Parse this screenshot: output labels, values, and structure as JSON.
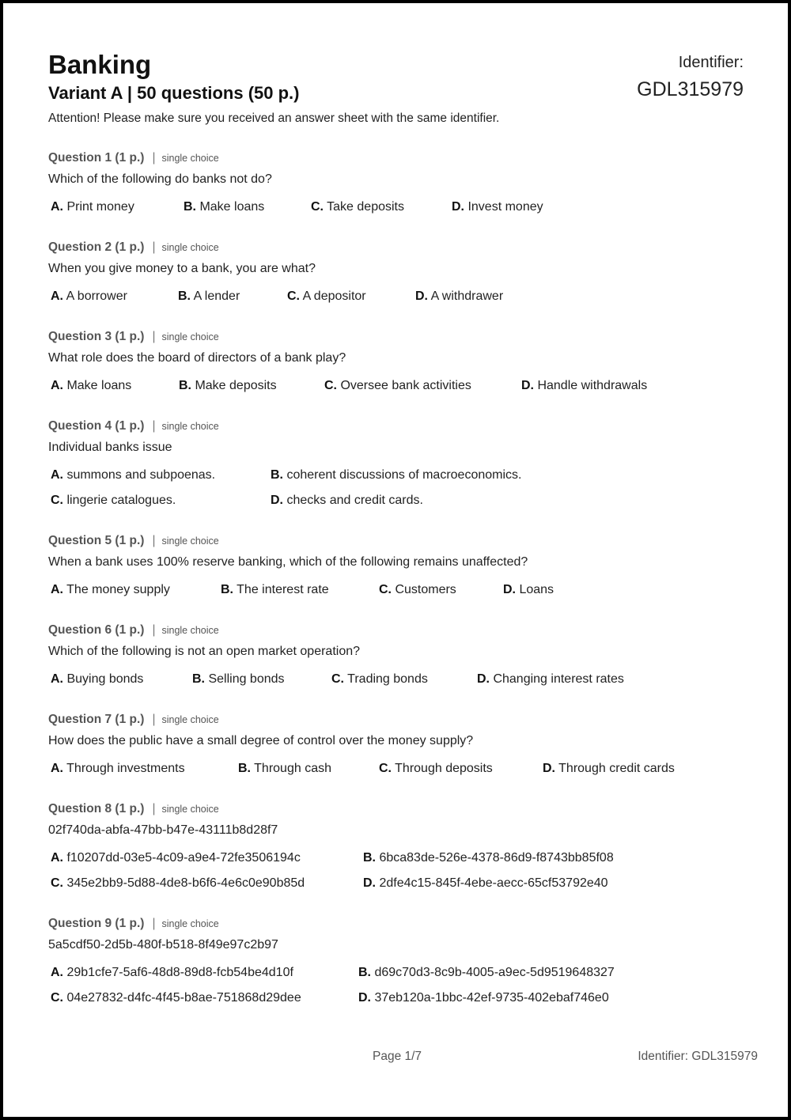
{
  "header": {
    "title": "Banking",
    "subtitle": "Variant A | 50 questions (50 p.)",
    "attention": "Attention! Please make sure you received an answer sheet with the same identifier.",
    "identifier_label": "Identifier:",
    "identifier_value": "GDL315979"
  },
  "questions": [
    {
      "heading": "Question 1 (1 p.)",
      "type": "single choice",
      "text": "Which of the following do banks not do?",
      "options": [
        {
          "letter": "A.",
          "text": "Print money"
        },
        {
          "letter": "B.",
          "text": "Make loans"
        },
        {
          "letter": "C.",
          "text": "Take deposits"
        },
        {
          "letter": "D.",
          "text": "Invest money"
        }
      ]
    },
    {
      "heading": "Question 2 (1 p.)",
      "type": "single choice",
      "text": "When you give money to a bank, you are what?",
      "options": [
        {
          "letter": "A.",
          "text": "A borrower"
        },
        {
          "letter": "B.",
          "text": "A lender"
        },
        {
          "letter": "C.",
          "text": "A depositor"
        },
        {
          "letter": "D.",
          "text": "A withdrawer"
        }
      ]
    },
    {
      "heading": "Question 3 (1 p.)",
      "type": "single choice",
      "text": "What role does the board of directors of a bank play?",
      "options": [
        {
          "letter": "A.",
          "text": "Make loans"
        },
        {
          "letter": "B.",
          "text": "Make deposits"
        },
        {
          "letter": "C.",
          "text": "Oversee bank activities"
        },
        {
          "letter": "D.",
          "text": "Handle withdrawals"
        }
      ]
    },
    {
      "heading": "Question 4 (1 p.)",
      "type": "single choice",
      "text": "Individual banks issue",
      "options": [
        {
          "letter": "A.",
          "text": "summons and subpoenas."
        },
        {
          "letter": "B.",
          "text": "coherent discussions of macroeconomics."
        },
        {
          "letter": "C.",
          "text": "lingerie catalogues."
        },
        {
          "letter": "D.",
          "text": "checks and credit cards."
        }
      ]
    },
    {
      "heading": "Question 5 (1 p.)",
      "type": "single choice",
      "text": "When a bank uses 100% reserve banking, which of the following remains unaffected?",
      "options": [
        {
          "letter": "A.",
          "text": "The money supply"
        },
        {
          "letter": "B.",
          "text": "The interest rate"
        },
        {
          "letter": "C.",
          "text": "Customers"
        },
        {
          "letter": "D.",
          "text": "Loans"
        }
      ]
    },
    {
      "heading": "Question 6 (1 p.)",
      "type": "single choice",
      "text": "Which of the following is not an open market operation?",
      "options": [
        {
          "letter": "A.",
          "text": "Buying bonds"
        },
        {
          "letter": "B.",
          "text": "Selling bonds"
        },
        {
          "letter": "C.",
          "text": "Trading bonds"
        },
        {
          "letter": "D.",
          "text": "Changing interest rates"
        }
      ]
    },
    {
      "heading": "Question 7 (1 p.)",
      "type": "single choice",
      "text": "How does the public have a small degree of control over the money supply?",
      "options": [
        {
          "letter": "A.",
          "text": "Through investments"
        },
        {
          "letter": "B.",
          "text": "Through cash"
        },
        {
          "letter": "C.",
          "text": "Through deposits"
        },
        {
          "letter": "D.",
          "text": "Through credit cards"
        }
      ]
    },
    {
      "heading": "Question 8 (1 p.)",
      "type": "single choice",
      "text": "02f740da-abfa-47bb-b47e-43111b8d28f7",
      "options": [
        {
          "letter": "A.",
          "text": "f10207dd-03e5-4c09-a9e4-72fe3506194c"
        },
        {
          "letter": "B.",
          "text": "6bca83de-526e-4378-86d9-f8743bb85f08"
        },
        {
          "letter": "C.",
          "text": "345e2bb9-5d88-4de8-b6f6-4e6c0e90b85d"
        },
        {
          "letter": "D.",
          "text": "2dfe4c15-845f-4ebe-aecc-65cf53792e40"
        }
      ]
    },
    {
      "heading": "Question 9 (1 p.)",
      "type": "single choice",
      "text": "5a5cdf50-2d5b-480f-b518-8f49e97c2b97",
      "options": [
        {
          "letter": "A.",
          "text": "29b1cfe7-5af6-48d8-89d8-fcb54be4d10f"
        },
        {
          "letter": "B.",
          "text": "d69c70d3-8c9b-4005-a9ec-5d9519648327"
        },
        {
          "letter": "C.",
          "text": "04e27832-d4fc-4f45-b8ae-751868d29dee"
        },
        {
          "letter": "D.",
          "text": "37eb120a-1bbc-42ef-9735-402ebaf746e0"
        }
      ]
    }
  ],
  "footer": {
    "page": "Page 1/7",
    "identifier": "Identifier: GDL315979"
  }
}
